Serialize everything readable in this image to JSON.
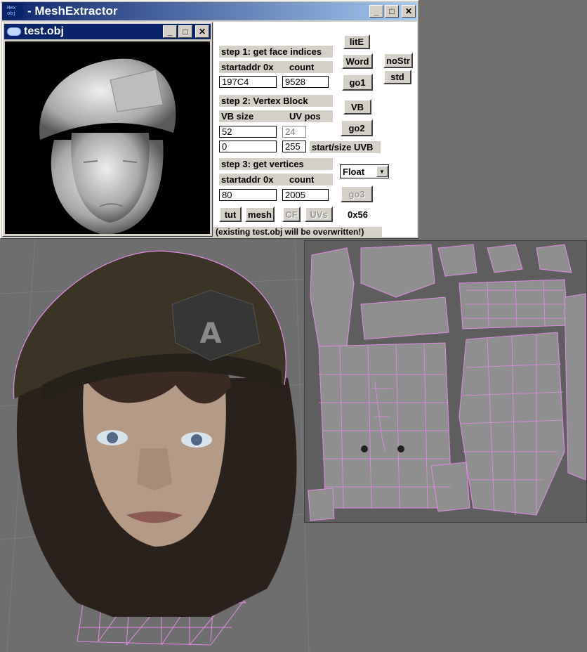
{
  "app": {
    "icon_text_1": "Hex",
    "icon_text_2": "obj",
    "title": "- MeshExtractor",
    "minimize": "_",
    "maximize": "□",
    "close": "✕"
  },
  "child_window": {
    "title": "test.obj",
    "minimize": "_",
    "maximize": "□",
    "close": "✕"
  },
  "step1": {
    "label": "step 1: get face indices",
    "startaddr_label": "startaddr 0x",
    "count_label": "count",
    "startaddr_value": "197C4",
    "count_value": "9528"
  },
  "step2": {
    "label": "step 2: Vertex Block",
    "vbsize_label": "VB size",
    "uvpos_label": "UV pos",
    "vbsize_value": "52",
    "uvpos_value": "24",
    "uvb_start_value": "0",
    "uvb_size_value": "255",
    "uvb_label": "start/size UVB"
  },
  "step3": {
    "label": "step 3: get vertices",
    "startaddr_label": "startaddr 0x",
    "count_label": "count",
    "startaddr_value": "80",
    "count_value": "2005"
  },
  "buttons": {
    "lite": "litE",
    "word": "Word",
    "nostr": "noStr",
    "std": "std",
    "go1": "go1",
    "vb": "VB",
    "go2": "go2",
    "go3": "go3",
    "tut": "tut",
    "mesh": "mesh",
    "cf": "CF",
    "uvs": "UVs"
  },
  "format_select": {
    "value": "Float"
  },
  "stride_text": "0x56",
  "footer_note": "(existing test.obj will be overwritten!)",
  "colors": {
    "title_active": "#0a246a",
    "wire": "#e58ae8",
    "face_gray": "#8e8e8e"
  }
}
